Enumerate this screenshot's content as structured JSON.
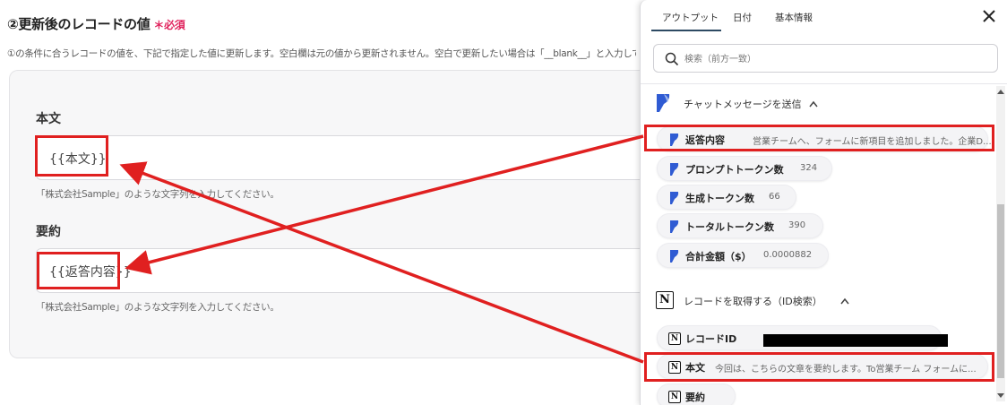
{
  "form": {
    "title": "②更新後のレコードの値",
    "required": "＊必須",
    "description": "①の条件に合うレコードの値を、下記で指定した値に更新します。空白欄は元の値から更新されません。空白で更新したい場合は「__blank__」と入力してくだ",
    "fields": [
      {
        "label": "本文",
        "value": "{{本文}}",
        "hint": "「株式会社Sample」のような文字列を入力してください。"
      },
      {
        "label": "要約",
        "value": "{{返答内容}}",
        "hint": "「株式会社Sample」のような文字列を入力してください。"
      }
    ]
  },
  "panel": {
    "tabs": [
      "アウトプット",
      "日付",
      "基本情報"
    ],
    "active_tab": "アウトプット",
    "search_placeholder": "検索（前方一致）",
    "groups": [
      {
        "title": "チャットメッセージを送信",
        "icon": "perplexity-icon",
        "items": [
          {
            "label": "返答内容",
            "value": "営業チームへ、フォームに新項目を追加しました。企業D..."
          },
          {
            "label": "プロンプトトークン数",
            "value": "324"
          },
          {
            "label": "生成トークン数",
            "value": "66"
          },
          {
            "label": "トータルトークン数",
            "value": "390"
          },
          {
            "label": "合計金額（$）",
            "value": "0.0000882"
          }
        ]
      },
      {
        "title": "レコードを取得する（ID検索）",
        "icon": "notion-icon",
        "items": [
          {
            "label": "レコードID",
            "value": ""
          },
          {
            "label": "本文",
            "value": "今回は、こちらの文章を要約します。To営業チーム フォームに..."
          },
          {
            "label": "要約",
            "value": ""
          }
        ]
      }
    ]
  },
  "colors": {
    "highlight": "#e02020",
    "required": "#e0245e",
    "tab_underline": "#2d4a63",
    "brand_blue": "#2f5bd3"
  }
}
